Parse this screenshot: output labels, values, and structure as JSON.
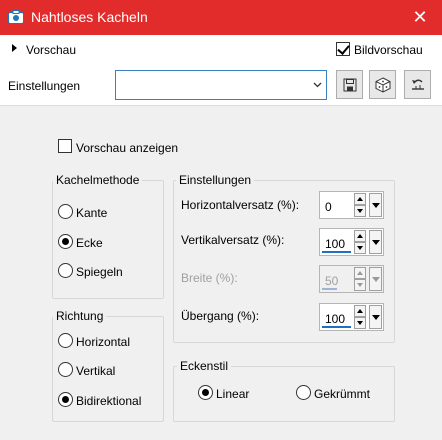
{
  "window": {
    "title": "Nahtloses Kacheln",
    "close_symbol": "✕"
  },
  "preview": {
    "label": "Vorschau",
    "bildvorschau_label": "Bildvorschau",
    "bildvorschau_checked": true
  },
  "settings": {
    "label": "Einstellungen",
    "preset_value": ""
  },
  "toolbar": {
    "icons": [
      "save-icon",
      "random-cube-icon",
      "reset-icon"
    ]
  },
  "show_preview": {
    "label": "Vorschau anzeigen",
    "checked": false
  },
  "tiling_method": {
    "title": "Kachelmethode",
    "options": [
      "Kante",
      "Ecke",
      "Spiegeln"
    ],
    "selected": "Ecke"
  },
  "direction": {
    "title": "Richtung",
    "options": [
      "Horizontal",
      "Vertikal",
      "Bidirektional"
    ],
    "selected": "Bidirektional"
  },
  "params": {
    "title": "Einstellungen",
    "horizontal_offset": {
      "label": "Horizontalversatz (%):",
      "value": "0",
      "bar_fraction": 0.0
    },
    "vertical_offset": {
      "label": "Vertikalversatz (%):",
      "value": "100",
      "bar_fraction": 1.0
    },
    "width": {
      "label": "Breite (%):",
      "value": "50",
      "disabled": true,
      "bar_fraction": 0.5
    },
    "transition": {
      "label": "Übergang (%):",
      "value": "100",
      "bar_fraction": 1.0
    }
  },
  "corner_style": {
    "title": "Eckenstil",
    "options": [
      "Linear",
      "Gekrümmt"
    ],
    "selected": "Linear"
  },
  "colors": {
    "titlebar": "#e22b2b",
    "accent": "#1f6fc5"
  }
}
